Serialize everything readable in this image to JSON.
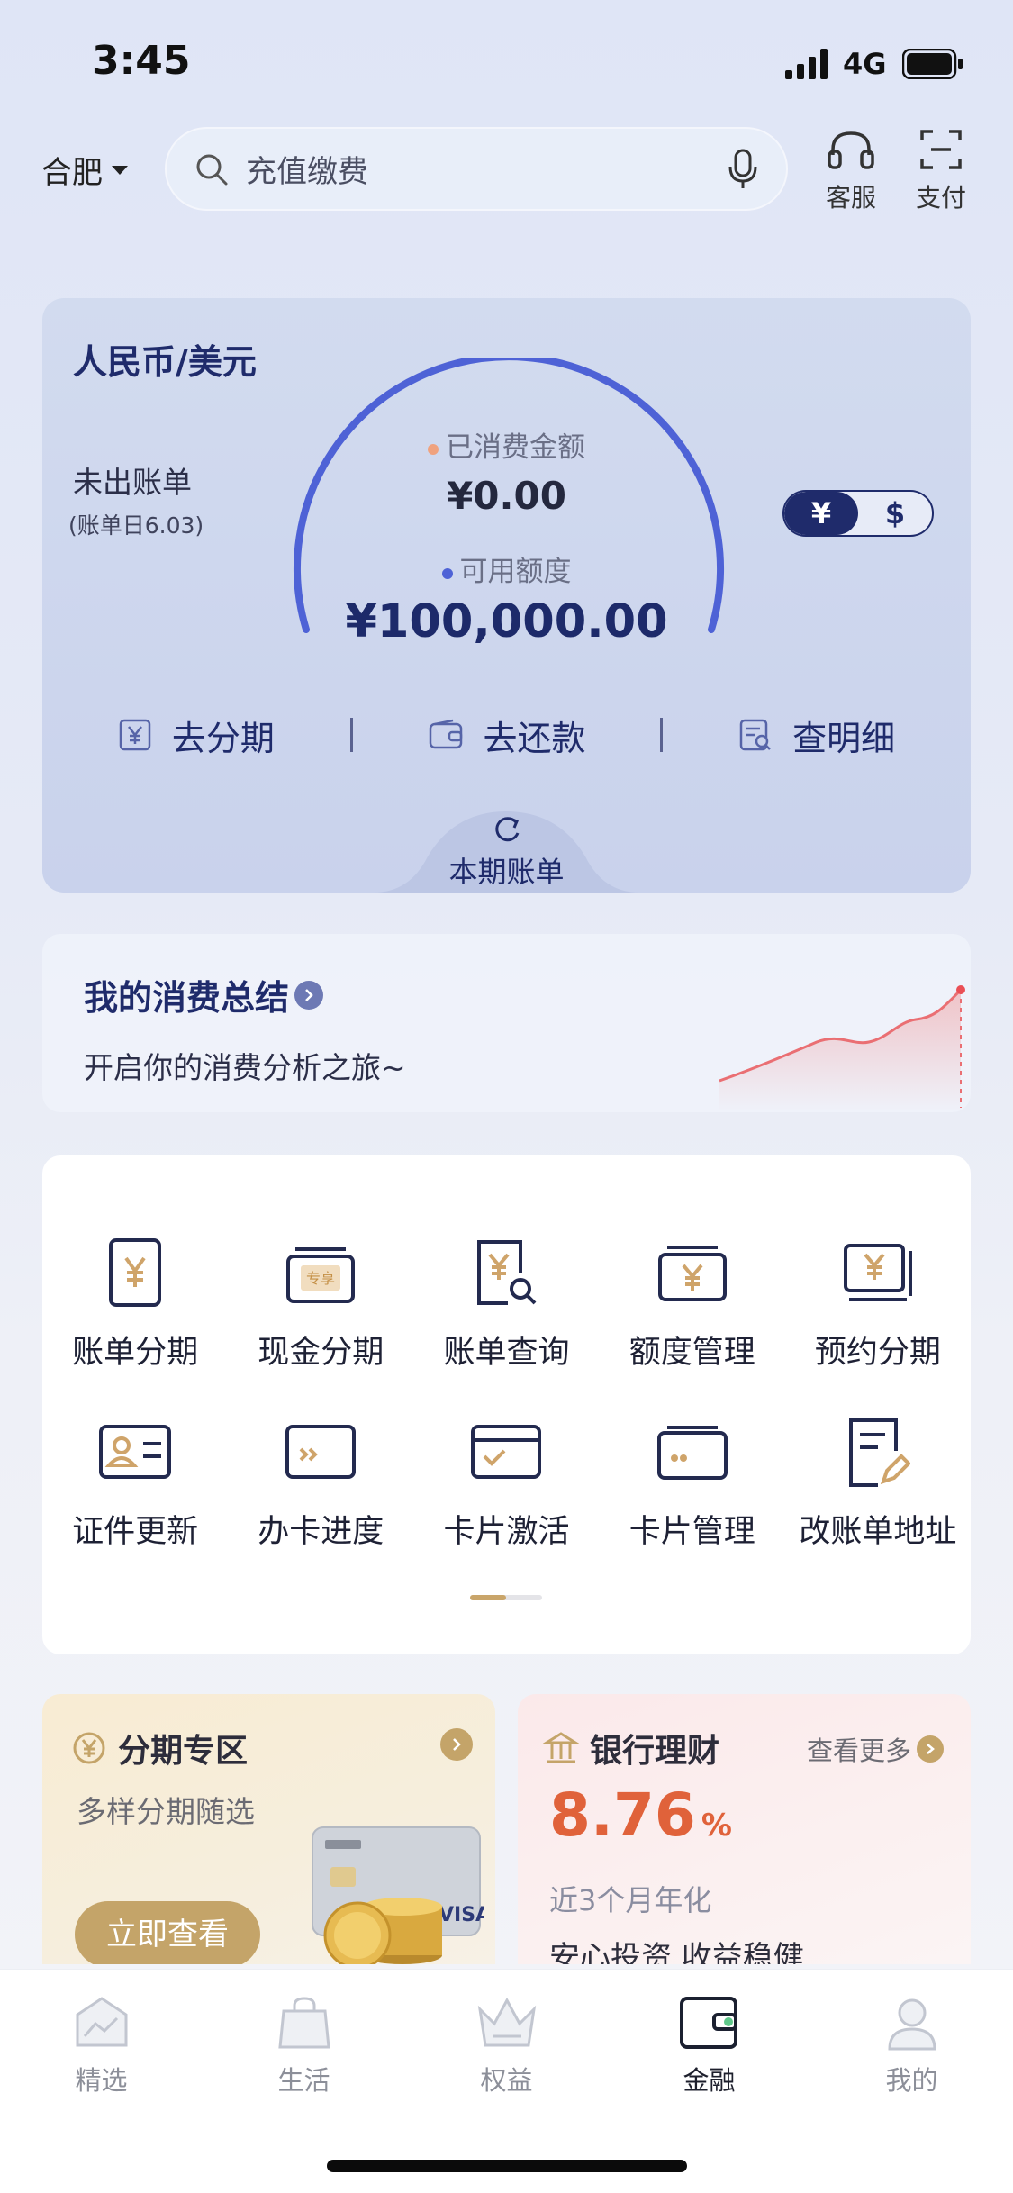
{
  "status_bar": {
    "time": "3:45",
    "network": "4G"
  },
  "topbar": {
    "city": "合肥",
    "search_placeholder": "充值缴费",
    "service_label": "客服",
    "pay_label": "支付"
  },
  "card": {
    "currency_title": "人民币/美元",
    "bill_status": "未出账单",
    "bill_date": "(账单日6.03)",
    "consumed_label": "已消费金额",
    "consumed_value": "¥0.00",
    "available_label": "可用额度",
    "available_value": "¥100,000.00",
    "toggle": {
      "cny": "¥",
      "usd": "$",
      "selected": "cny"
    },
    "actions": [
      {
        "label": "去分期",
        "icon": "yen-box-icon"
      },
      {
        "label": "去还款",
        "icon": "wallet-icon"
      },
      {
        "label": "查明细",
        "icon": "detail-search-icon"
      }
    ],
    "current_bill_tab": "本期账单",
    "colors": {
      "gauge": "#4e62d6",
      "consumed_dot": "#f0a27e",
      "available_dot": "#4e62d6"
    }
  },
  "summary": {
    "title": "我的消费总结",
    "subtitle": "开启你的消费分析之旅~"
  },
  "services": [
    {
      "label": "账单分期",
      "icon": "bill-installment-icon"
    },
    {
      "label": "现金分期",
      "icon": "cash-installment-icon",
      "badge": "专享"
    },
    {
      "label": "账单查询",
      "icon": "bill-query-icon"
    },
    {
      "label": "额度管理",
      "icon": "limit-management-icon"
    },
    {
      "label": "预约分期",
      "icon": "scheduled-installment-icon"
    },
    {
      "label": "证件更新",
      "icon": "id-update-icon"
    },
    {
      "label": "办卡进度",
      "icon": "card-progress-icon"
    },
    {
      "label": "卡片激活",
      "icon": "card-activate-icon"
    },
    {
      "label": "卡片管理",
      "icon": "card-management-icon"
    },
    {
      "label": "改账单地址",
      "icon": "address-edit-icon"
    }
  ],
  "promo_installment": {
    "title": "分期专区",
    "subtitle": "多样分期随选",
    "button": "立即查看",
    "card_text": "VISA"
  },
  "promo_wealth": {
    "title": "银行理财",
    "more": "查看更多",
    "rate": "8.76",
    "rate_unit": "%",
    "rate_label": "近3个月年化",
    "description": "安心投资 收益稳健"
  },
  "tabbar": [
    {
      "label": "精选",
      "icon": "featured-icon",
      "active": false
    },
    {
      "label": "生活",
      "icon": "life-bag-icon",
      "active": false
    },
    {
      "label": "权益",
      "icon": "crown-icon",
      "active": false
    },
    {
      "label": "金融",
      "icon": "finance-wallet-icon",
      "active": true
    },
    {
      "label": "我的",
      "icon": "profile-icon",
      "active": false
    }
  ],
  "accent_colors": {
    "navy": "#1f2b6b",
    "gold": "#c4a469",
    "rate_orange": "#e0623a"
  }
}
